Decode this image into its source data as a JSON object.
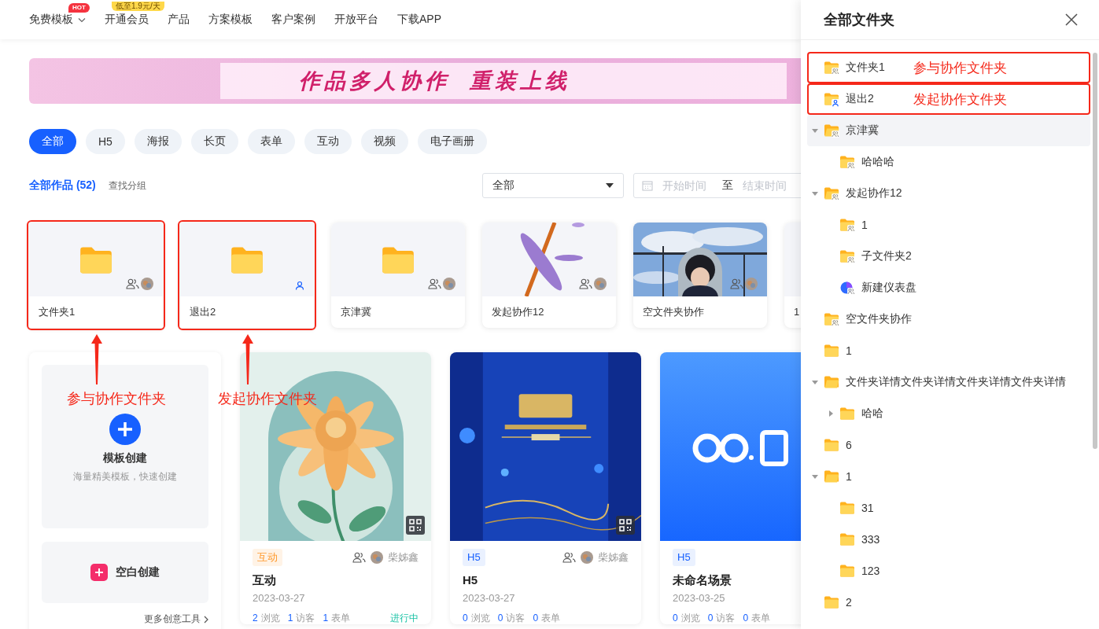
{
  "nav": {
    "items": [
      {
        "label": "免费模板",
        "dropdown": true,
        "badge": {
          "text": "HOT",
          "kind": "hot"
        }
      },
      {
        "label": "开通会员",
        "badge": {
          "text": "低至1.9元/天",
          "kind": "promo"
        }
      },
      {
        "label": "产品"
      },
      {
        "label": "方案模板"
      },
      {
        "label": "客户案例"
      },
      {
        "label": "开放平台"
      },
      {
        "label": "下载APP"
      }
    ]
  },
  "banner": {
    "headline": "作品多人协作  重装上线"
  },
  "filters": [
    {
      "label": "全部",
      "selected": true
    },
    {
      "label": "H5",
      "selected": false
    },
    {
      "label": "海报",
      "selected": false
    },
    {
      "label": "长页",
      "selected": false
    },
    {
      "label": "表单",
      "selected": false
    },
    {
      "label": "互动",
      "selected": false
    },
    {
      "label": "视频",
      "selected": false
    },
    {
      "label": "电子画册",
      "selected": false
    }
  ],
  "works_header": {
    "title": "全部作品 (52)",
    "link": "查找分组",
    "select": {
      "value": "全部"
    },
    "date_range": {
      "start_placeholder": "开始时间",
      "separator": "至",
      "end_placeholder": "结束时间"
    }
  },
  "folders": [
    {
      "name": "文件夹1",
      "kind": "shared_folder",
      "annotation": "参与协作文件夹"
    },
    {
      "name": "退出2",
      "kind": "owned_folder",
      "annotation": "发起协作文件夹"
    },
    {
      "name": "京津冀",
      "kind": "shared_folder"
    },
    {
      "name": "发起协作12",
      "kind": "shared_picture"
    },
    {
      "name": "空文件夹协作",
      "kind": "shared_picture"
    },
    {
      "name": "1",
      "kind": "blank"
    }
  ],
  "create": {
    "template": {
      "title": "模板创建",
      "subtitle": "海量精美模板，快速创建"
    },
    "blank": {
      "title": "空白创建"
    },
    "more": "更多创意工具"
  },
  "works": [
    {
      "qr": true,
      "tag": {
        "text": "互动",
        "kind": "interactive"
      },
      "collab": true,
      "author": "柴姊鑫",
      "title": "互动",
      "date": "2023-03-27",
      "stats": [
        {
          "count": "2",
          "label": "浏览"
        },
        {
          "count": "1",
          "label": "访客"
        },
        {
          "count": "1",
          "label": "表单"
        }
      ],
      "status": "进行中"
    },
    {
      "qr": true,
      "tag": {
        "text": "H5",
        "kind": "h5"
      },
      "collab": true,
      "author": "柴姊鑫",
      "title": "H5",
      "date": "2023-03-27",
      "stats": [
        {
          "count": "0",
          "label": "浏览"
        },
        {
          "count": "0",
          "label": "访客"
        },
        {
          "count": "0",
          "label": "表单"
        }
      ]
    },
    {
      "tag": {
        "text": "H5",
        "kind": "h5"
      },
      "title": "未命名场景",
      "date": "2023-03-25",
      "stats": [
        {
          "count": "0",
          "label": "浏览"
        },
        {
          "count": "0",
          "label": "访客"
        },
        {
          "count": "0",
          "label": "表单"
        }
      ]
    }
  ],
  "drawer": {
    "title": "全部文件夹",
    "tree": [
      {
        "name": "文件夹1",
        "kind": "shared_folder",
        "selected": false,
        "annotation": "参与协作文件夹"
      },
      {
        "name": "退出2",
        "kind": "owned_folder",
        "selected": false,
        "annotation": "发起协作文件夹"
      },
      {
        "name": "京津冀",
        "kind": "shared_folder",
        "selected": true,
        "expanded": true,
        "children": [
          {
            "name": "哈哈哈",
            "kind": "shared_folder",
            "selected": false
          }
        ]
      },
      {
        "name": "发起协作12",
        "kind": "shared_folder",
        "selected": false,
        "expanded": true,
        "children": [
          {
            "name": "1",
            "kind": "shared_folder",
            "selected": false
          },
          {
            "name": "子文件夹2",
            "kind": "shared_folder",
            "selected": false
          },
          {
            "name": "新建仪表盘",
            "kind": "shared_dashboard",
            "selected": false
          }
        ]
      },
      {
        "name": "空文件夹协作",
        "kind": "shared_folder",
        "selected": false
      },
      {
        "name": "1",
        "kind": "folder",
        "selected": false
      },
      {
        "name": "文件夹详情文件夹详情文件夹详情文件夹详情",
        "kind": "folder",
        "selected": false,
        "expanded": true,
        "children": [
          {
            "name": "哈哈",
            "kind": "folder",
            "selected": false,
            "expanded": false
          }
        ]
      },
      {
        "name": "6",
        "kind": "folder",
        "selected": false
      },
      {
        "name": "1",
        "kind": "folder",
        "selected": false,
        "expanded": true,
        "children": [
          {
            "name": "31",
            "kind": "folder",
            "selected": false
          },
          {
            "name": "333",
            "kind": "folder",
            "selected": false
          },
          {
            "name": "123",
            "kind": "folder",
            "selected": false
          }
        ]
      },
      {
        "name": "2",
        "kind": "folder",
        "selected": false
      }
    ]
  }
}
